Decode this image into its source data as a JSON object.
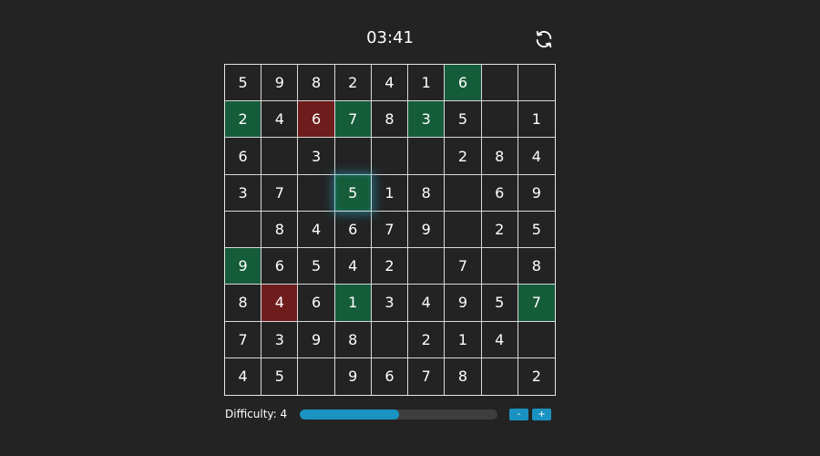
{
  "timer": "03:41",
  "difficulty": {
    "label": "Difficulty: 4",
    "level": 4,
    "progress_fraction": 0.5,
    "minus_label": "-",
    "plus_label": "+"
  },
  "colors": {
    "background": "#232323",
    "given_cell": "#155c3a",
    "error_cell": "#6f1c1c",
    "accent": "#1a93c2"
  },
  "board": [
    [
      "5",
      "9",
      "8",
      "2",
      "4",
      "1",
      "6",
      "",
      ""
    ],
    [
      "2",
      "4",
      "6",
      "7",
      "8",
      "3",
      "5",
      "",
      "1"
    ],
    [
      "6",
      "",
      "3",
      "",
      "",
      "",
      "2",
      "8",
      "4"
    ],
    [
      "3",
      "7",
      "",
      "5",
      "1",
      "8",
      "",
      "6",
      "9"
    ],
    [
      "",
      "8",
      "4",
      "6",
      "7",
      "9",
      "",
      "2",
      "5"
    ],
    [
      "9",
      "6",
      "5",
      "4",
      "2",
      "",
      "7",
      "",
      "8"
    ],
    [
      "8",
      "4",
      "6",
      "1",
      "3",
      "4",
      "9",
      "5",
      "7"
    ],
    [
      "7",
      "3",
      "9",
      "8",
      "",
      "2",
      "1",
      "4",
      ""
    ],
    [
      "4",
      "5",
      "",
      "9",
      "6",
      "7",
      "8",
      "",
      "2"
    ]
  ],
  "cell_states": [
    [
      "",
      "",
      "",
      "",
      "",
      "",
      "given",
      "",
      ""
    ],
    [
      "given",
      "",
      "error",
      "given",
      "",
      "given",
      "",
      "",
      ""
    ],
    [
      "",
      "",
      "",
      "",
      "",
      "",
      "",
      "",
      ""
    ],
    [
      "",
      "",
      "",
      "selected",
      "",
      "",
      "",
      "",
      ""
    ],
    [
      "",
      "",
      "",
      "",
      "",
      "",
      "",
      "",
      ""
    ],
    [
      "given",
      "",
      "",
      "",
      "",
      "",
      "",
      "",
      ""
    ],
    [
      "",
      "error",
      "",
      "given",
      "",
      "",
      "",
      "",
      "given"
    ],
    [
      "",
      "",
      "",
      "",
      "",
      "",
      "",
      "",
      ""
    ],
    [
      "",
      "",
      "",
      "",
      "",
      "",
      "",
      "",
      ""
    ]
  ]
}
